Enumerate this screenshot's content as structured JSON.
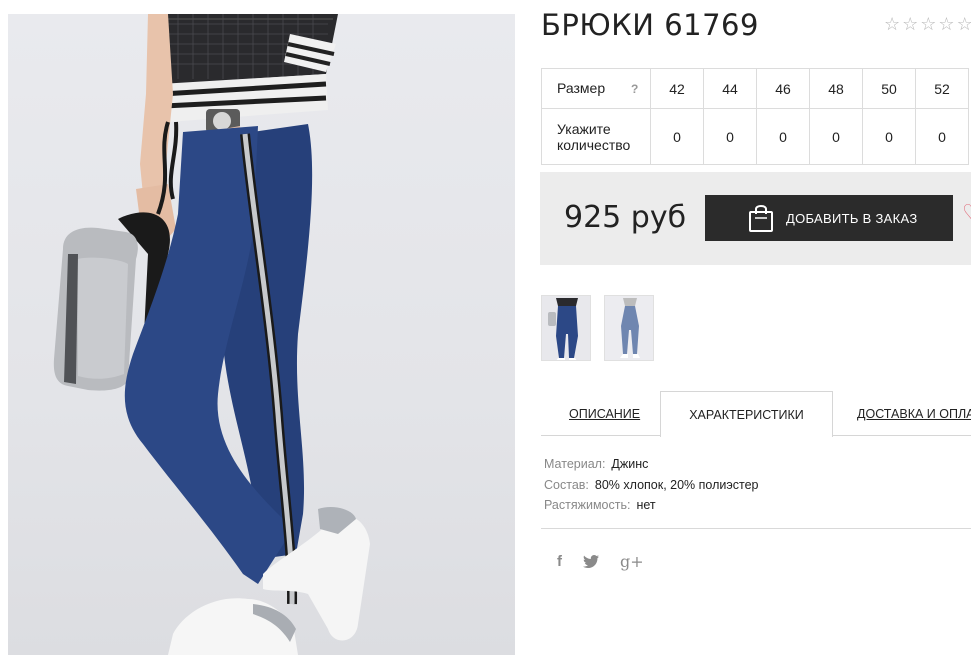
{
  "product": {
    "title": "БРЮКИ 61769",
    "rating_icons": [
      "☆",
      "☆",
      "☆",
      "☆",
      "☆"
    ]
  },
  "size_table": {
    "size_label": "Размер",
    "help_icon": "?",
    "sizes": [
      "42",
      "44",
      "46",
      "48",
      "50",
      "52"
    ],
    "qty_label_line1": "Укажите",
    "qty_label_line2": "количество",
    "quantities": [
      "0",
      "0",
      "0",
      "0",
      "0",
      "0"
    ]
  },
  "buy": {
    "price": "925 руб",
    "button_label": "ДОБАВИТЬ В ЗАКАЗ",
    "button_icon": "shopping-bag-icon",
    "wishlist_icon": "heart-icon"
  },
  "tabs": [
    {
      "label": "ОПИСАНИЕ",
      "active": false
    },
    {
      "label": "ХАРАКТЕРИСТИКИ",
      "active": true
    },
    {
      "label": "ДОСТАВКА И ОПЛАТА",
      "active": false
    }
  ],
  "characteristics": [
    {
      "key": "Материал:",
      "value": "Джинс"
    },
    {
      "key": "Состав:",
      "value": "80% хлопок, 20% полиэстер"
    },
    {
      "key": "Растяжимость:",
      "value": "нет"
    }
  ],
  "social": {
    "facebook": "f",
    "google_plus": "g+"
  },
  "colors": {
    "button_bg": "#2b2b2b",
    "buybox_bg": "#ececec",
    "denim": "#253f78",
    "heart": "#e26b7a"
  }
}
